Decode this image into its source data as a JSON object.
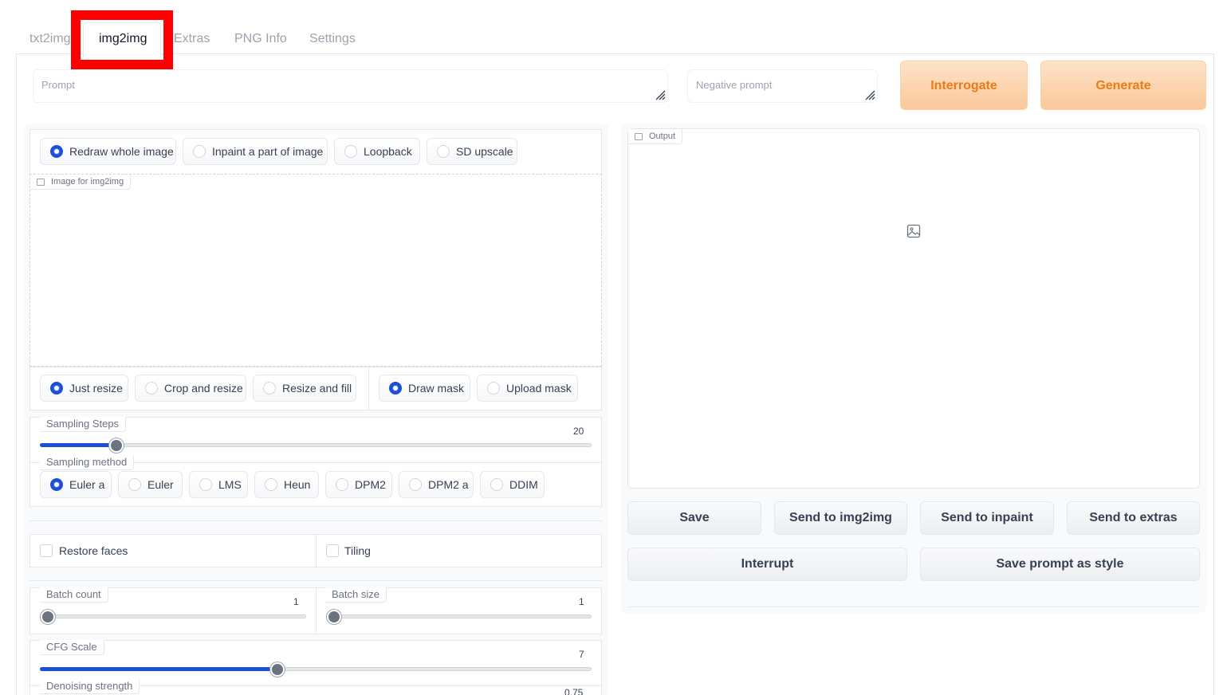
{
  "tabs": [
    {
      "label": "txt2img"
    },
    {
      "label": "img2img",
      "active": true
    },
    {
      "label": "Extras"
    },
    {
      "label": "PNG Info"
    },
    {
      "label": "Settings"
    }
  ],
  "prompt": {
    "placeholder": "Prompt"
  },
  "negative_prompt": {
    "placeholder": "Negative prompt"
  },
  "actions": {
    "interrogate": "Interrogate",
    "generate": "Generate"
  },
  "mode_options": [
    {
      "label": "Redraw whole image",
      "selected": true
    },
    {
      "label": "Inpaint a part of image",
      "selected": false
    },
    {
      "label": "Loopback",
      "selected": false
    },
    {
      "label": "SD upscale",
      "selected": false
    }
  ],
  "image_input": {
    "label": "Image for img2img"
  },
  "resize_options": [
    {
      "label": "Just resize",
      "selected": true
    },
    {
      "label": "Crop and resize",
      "selected": false
    },
    {
      "label": "Resize and fill",
      "selected": false
    }
  ],
  "mask_options": [
    {
      "label": "Draw mask",
      "selected": true
    },
    {
      "label": "Upload mask",
      "selected": false
    }
  ],
  "sampling_steps": {
    "label": "Sampling Steps",
    "value": "20"
  },
  "sampling_method": {
    "label": "Sampling method",
    "options": [
      {
        "label": "Euler a",
        "selected": true
      },
      {
        "label": "Euler",
        "selected": false
      },
      {
        "label": "LMS",
        "selected": false
      },
      {
        "label": "Heun",
        "selected": false
      },
      {
        "label": "DPM2",
        "selected": false
      },
      {
        "label": "DPM2 a",
        "selected": false
      },
      {
        "label": "DDIM",
        "selected": false
      }
    ]
  },
  "restore_faces": {
    "label": "Restore faces"
  },
  "tiling": {
    "label": "Tiling"
  },
  "batch_count": {
    "label": "Batch count",
    "value": "1"
  },
  "batch_size": {
    "label": "Batch size",
    "value": "1"
  },
  "cfg_scale": {
    "label": "CFG Scale",
    "value": "7"
  },
  "denoising_strength": {
    "label": "Denoising strength",
    "value": "0.75"
  },
  "output": {
    "label": "Output"
  },
  "output_buttons": {
    "save": "Save",
    "send_img2img": "Send to img2img",
    "send_inpaint": "Send to inpaint",
    "send_extras": "Send to extras",
    "interrupt": "Interrupt",
    "save_style": "Save prompt as style"
  },
  "colors": {
    "accent": "#1d4ed8",
    "primary_button": "#ea7a1a",
    "highlight": "#ff0000"
  }
}
